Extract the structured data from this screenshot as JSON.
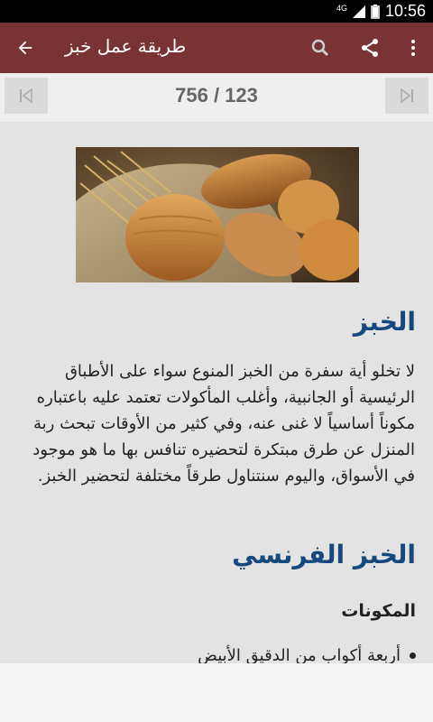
{
  "status_bar": {
    "network": "4G",
    "time": "10:56"
  },
  "app_bar": {
    "title": "طريقة عمل خبز"
  },
  "pager": {
    "counter": "756 / 123"
  },
  "article": {
    "image_alt": "خبز",
    "heading1": "الخبز",
    "paragraph": "لا تخلو أية سفرة من الخبز المنوع سواء على الأطباق الرئيسية أو الجانبية، وأغلب المأكولات تعتمد عليه باعتباره مكوناً أساسياً لا غنى عنه، وفي كثير من الأوقات تبحث ربة المنزل عن طرق مبتكرة لتحضيره تنافس بها ما هو موجود في الأسواق، واليوم سنتناول طرقاً مختلفة لتحضير الخبز.",
    "heading2": "الخبز الفرنسي",
    "section_title": "المكونات",
    "ingredients": [
      "أربعة أكواب من الدقيق الأبيض"
    ]
  },
  "colors": {
    "appbar": "#7a3333",
    "heading": "#17487d"
  }
}
